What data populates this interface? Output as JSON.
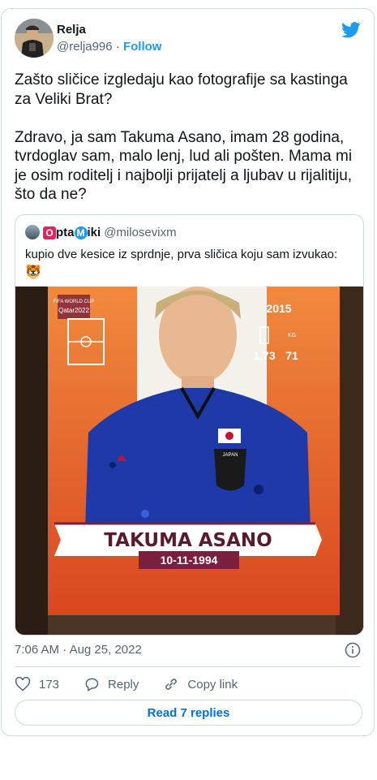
{
  "author": {
    "name": "Relja",
    "handle": "@relja996",
    "separator": "·",
    "follow_label": "Follow"
  },
  "tweet": {
    "text": "Zašto sličice izgledaju kao fotografije sa kastinga za Veliki Brat?\n\nZdravo, ja sam Takuma Asano, imam 28 godina, tvrdoglav sam, malo lenj, lud ali pošten. Mama mi je osim roditelj i najbolji prijatelj a ljubav u rijalitiju, što da ne?"
  },
  "quoted": {
    "name_badge_1": "O",
    "name_part_1": "pta",
    "name_badge_2": "M",
    "name_part_2": "iki",
    "handle": "@milosevixm",
    "text": "kupio dve kesice iz sprdnje, prva sličica koju sam izvukao:",
    "emoji": "🐯",
    "sticker": {
      "tournament": "FIFA WORLD CUP",
      "host": "Qatar2022",
      "year": "2015",
      "height": "1,73",
      "weight": "71",
      "weight_unit": "KG",
      "team_label": "JAPAN",
      "player_name": "TAKUMA ASANO",
      "birth_date": "10-11-1994"
    }
  },
  "timestamp": {
    "time": "7:06 AM",
    "separator": "·",
    "date": "Aug 25, 2022"
  },
  "actions": {
    "likes": "173",
    "reply_label": "Reply",
    "copy_label": "Copy link"
  },
  "read_replies_label": "Read 7 replies",
  "colors": {
    "accent": "#1d9bf0",
    "link_button": "#006fd6",
    "secondary_text": "#536471",
    "border": "#cfd9de",
    "sticker_orange": "#e8612c",
    "jersey_blue": "#1e3aa8"
  }
}
